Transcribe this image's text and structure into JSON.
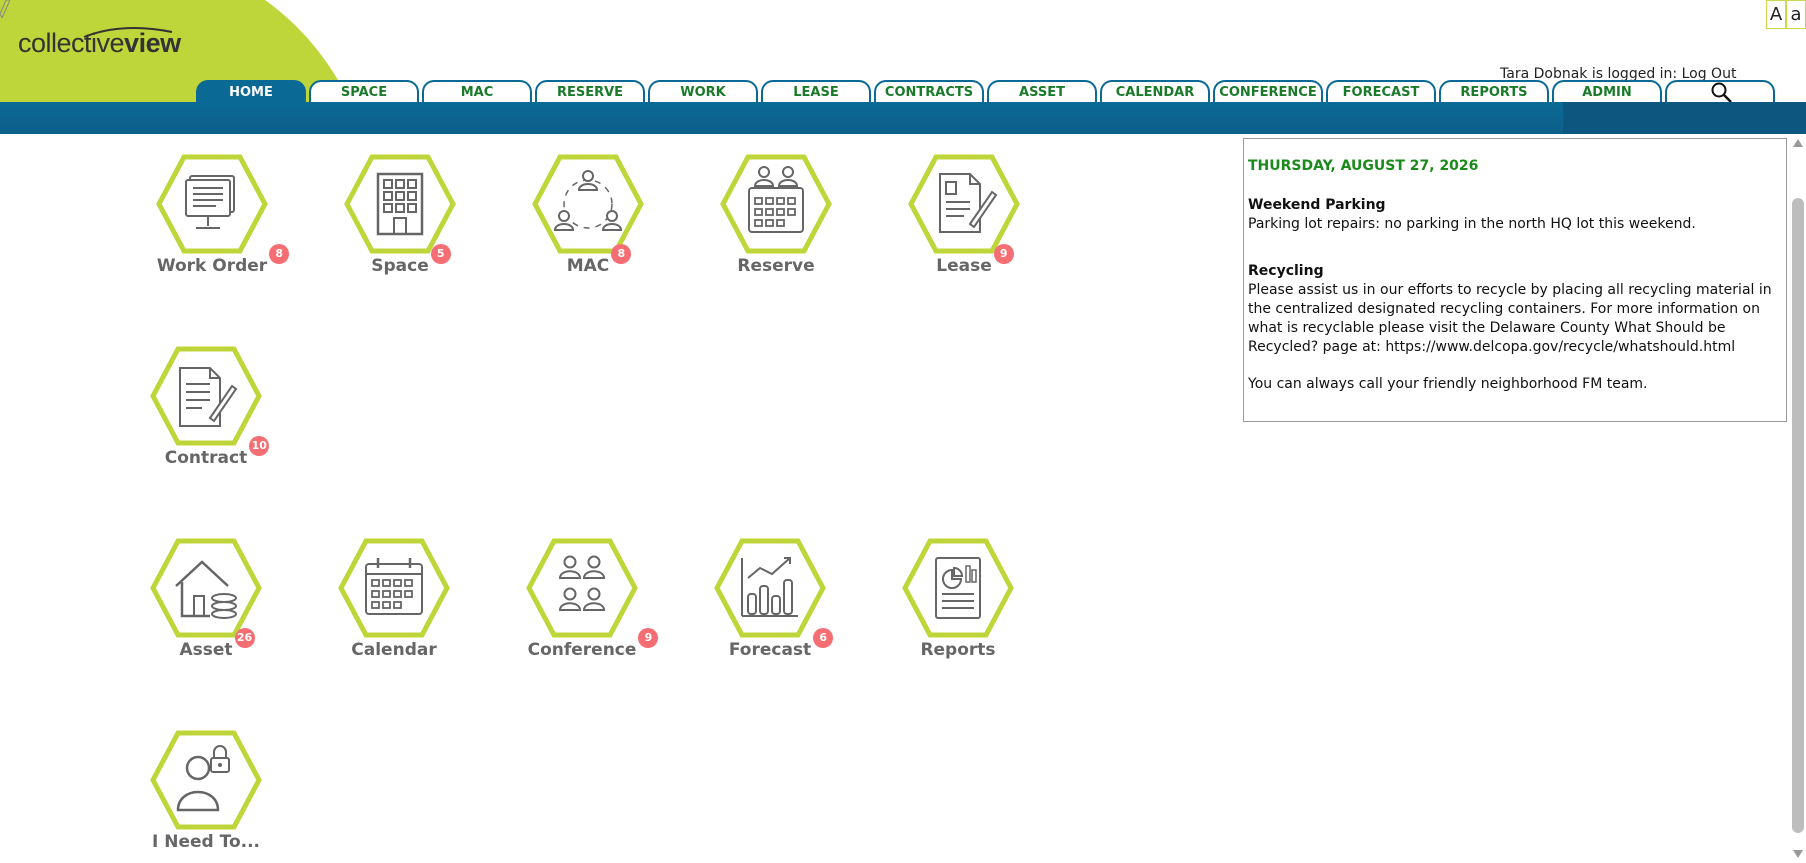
{
  "header": {
    "logo_part1": "collective",
    "logo_part2": "view",
    "font_small": "A",
    "font_large": "a",
    "login_text": "Tara Dobnak is logged in:",
    "logout_label": "Log Out"
  },
  "colors": {
    "brand_green": "#bed63a",
    "brand_blue": "#0a6a95",
    "tab_text_green": "#1a7a2a",
    "badge_red": "#f46e73",
    "date_green": "#1a8a1a"
  },
  "tabs": [
    {
      "label": "HOME",
      "active": true
    },
    {
      "label": "SPACE"
    },
    {
      "label": "MAC"
    },
    {
      "label": "RESERVE"
    },
    {
      "label": "WORK"
    },
    {
      "label": "LEASE"
    },
    {
      "label": "CONTRACTS"
    },
    {
      "label": "ASSET"
    },
    {
      "label": "CALENDAR"
    },
    {
      "label": "CONFERENCE"
    },
    {
      "label": "FORECAST"
    },
    {
      "label": "REPORTS"
    },
    {
      "label": "ADMIN"
    },
    {
      "label": "",
      "icon": "search-icon"
    }
  ],
  "tiles": [
    {
      "label": "Work Order",
      "badge": "8",
      "icon": "work-order-icon"
    },
    {
      "label": "Space",
      "badge": "5",
      "icon": "building-icon"
    },
    {
      "label": "MAC",
      "badge": "8",
      "icon": "people-circle-icon"
    },
    {
      "label": "Reserve",
      "badge": "",
      "icon": "reserve-calendar-icon"
    },
    {
      "label": "Lease",
      "badge": "9",
      "icon": "lease-document-icon"
    },
    {
      "label": "Contract",
      "badge": "10",
      "icon": "contract-document-icon"
    },
    {
      "label": "Asset",
      "badge": "26",
      "icon": "asset-house-icon"
    },
    {
      "label": "Calendar",
      "badge": "",
      "icon": "calendar-icon"
    },
    {
      "label": "Conference",
      "badge": "9",
      "icon": "conference-people-icon"
    },
    {
      "label": "Forecast",
      "badge": "6",
      "icon": "forecast-chart-icon"
    },
    {
      "label": "Reports",
      "badge": "",
      "icon": "reports-icon"
    },
    {
      "label": "I Need To...",
      "badge": "",
      "icon": "user-lock-icon"
    }
  ],
  "news": {
    "date": "THURSDAY, AUGUST 27, 2026",
    "items": [
      {
        "title": "Weekend Parking",
        "body": "Parking lot repairs: no parking in the north HQ lot this weekend."
      },
      {
        "title": "Recycling",
        "body": "Please assist us in our efforts to recycle by placing all recycling material in the centralized designated recycling containers. For more information on what is recyclable please visit the Delaware County What Should be Recycled? page at: https://www.delcopa.gov/recycle/whatshould.html"
      }
    ],
    "footer": "You can always call your friendly neighborhood FM team."
  }
}
